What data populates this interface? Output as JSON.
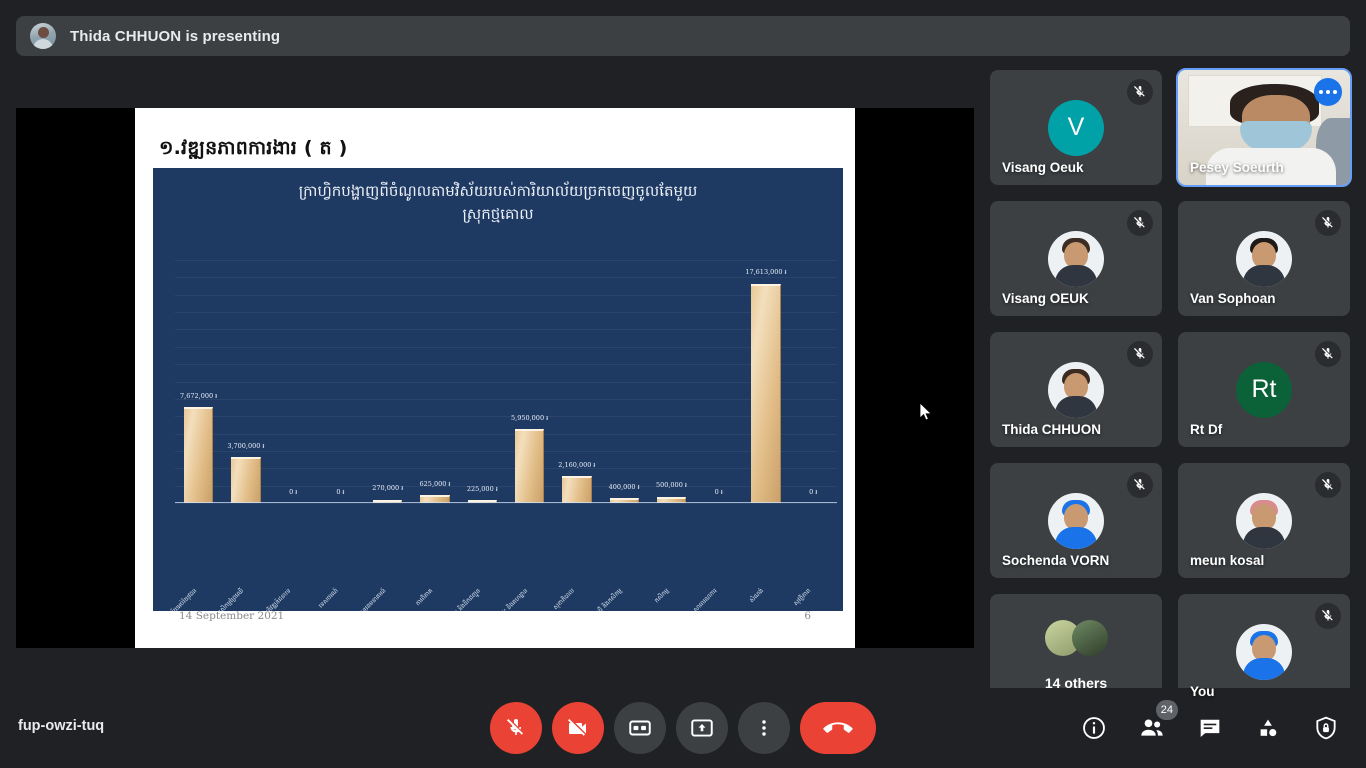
{
  "banner": {
    "text": "Thida CHHUON is presenting",
    "avatar_icon": "presenter-avatar"
  },
  "slide": {
    "title": "១.វឌ្ឍនភាពការងារ ( ត )",
    "chart_title_line1": "ក្រាហ្វិកបង្ហាញពីចំណូលតាមវិស័យរបស់ការិយាល័យច្រកចេញចូលតែមួយ",
    "chart_title_line2": "ស្រុកថ្មគោល",
    "date": "14 September 2021",
    "page_number": "6"
  },
  "chart_data": {
    "type": "bar",
    "title": "ក្រាហ្វិកបង្ហាញពីចំណូលតាមវិស័យរបស់ការិយាល័យច្រកចេញចូលតែមួយស្រុកថ្មគោល",
    "xlabel": "",
    "ylabel": "",
    "ylim": [
      0,
      19500000
    ],
    "grid": true,
    "legend": false,
    "currency_symbol": "៛",
    "categories": [
      "វិស័យអប់រំយុវជន",
      "កសិកម្មព្រៃឈើ",
      "អភិវឌ្ឍន៍ជនបទ",
      "ទេសចរណ៍",
      "ប្រៃសណីយ៍ និងទូរគមនាគមន៍",
      "ការពិភាគ",
      "សាធារណការ និងដឹកជញ្ជូន",
      "ផ្ទះ និងគហដ្ឋាន",
      "សុខាភិបាល",
      "រៀបចំដែនដី និងកសិកម្ម",
      "កសិកម្ម",
      "សាធារណការ",
      "សំណង់",
      "សុវត្ថិភាព"
    ],
    "values": [
      7672000,
      3700000,
      0,
      0,
      270000,
      625000,
      225000,
      5950000,
      2160000,
      400000,
      500000,
      0,
      17613000,
      0
    ],
    "value_labels": [
      "7,672,000 ៛",
      "3,700,000 ៛",
      "0 ៛",
      "0 ៛",
      "270,000 ៛",
      "625,000 ៛",
      "225,000 ៛",
      "5,950,000 ៛",
      "2,160,000 ៛",
      "400,000 ៛",
      "500,000 ៛",
      "0 ៛",
      "17,613,000 ៛",
      "0 ៛"
    ]
  },
  "participants": [
    {
      "name": "Visang Oeuk",
      "avatar_type": "initials",
      "initials": "V",
      "avatar_color": "#00a2a8",
      "muted": true,
      "active": false
    },
    {
      "name": "Pesey Soeurth",
      "avatar_type": "video",
      "initials": "",
      "avatar_color": "#b98a63",
      "muted": false,
      "active": true
    },
    {
      "name": "Visang OEUK",
      "avatar_type": "photo",
      "initials": "",
      "avatar_color": "#3e2d23",
      "muted": true,
      "active": false
    },
    {
      "name": "Van Sophoan",
      "avatar_type": "photo",
      "initials": "",
      "avatar_color": "#1d1a17",
      "muted": true,
      "active": false
    },
    {
      "name": "Thida CHHUON",
      "avatar_type": "photo",
      "initials": "",
      "avatar_color": "#3b2a20",
      "muted": true,
      "active": false
    },
    {
      "name": "Rt Df",
      "avatar_type": "initials",
      "initials": "Rt",
      "avatar_color": "#0b6138",
      "muted": true,
      "active": false
    },
    {
      "name": "Sochenda VORN",
      "avatar_type": "photo",
      "initials": "",
      "avatar_color": "#1a73e8",
      "muted": true,
      "active": false
    },
    {
      "name": "meun kosal",
      "avatar_type": "photo",
      "initials": "",
      "avatar_color": "#d98c8c",
      "muted": true,
      "active": false
    },
    {
      "name": "14 others",
      "avatar_type": "group",
      "initials": "",
      "avatar_color": "#8d9a6b",
      "muted": false,
      "active": false
    },
    {
      "name": "You",
      "avatar_type": "photo",
      "initials": "",
      "avatar_color": "#1a73e8",
      "muted": true,
      "active": false
    }
  ],
  "toolbar": {
    "meeting_code": "fup-owzi-tuq",
    "mic_label": "Turn on microphone",
    "camera_label": "Turn on camera",
    "captions_label": "Turn on captions",
    "present_label": "Present now",
    "more_label": "More options",
    "leave_label": "Leave call",
    "info_label": "Meeting details",
    "people_label": "Show everyone",
    "people_count": "24",
    "chat_label": "Chat with everyone",
    "activities_label": "Activities",
    "host_label": "Host controls"
  }
}
